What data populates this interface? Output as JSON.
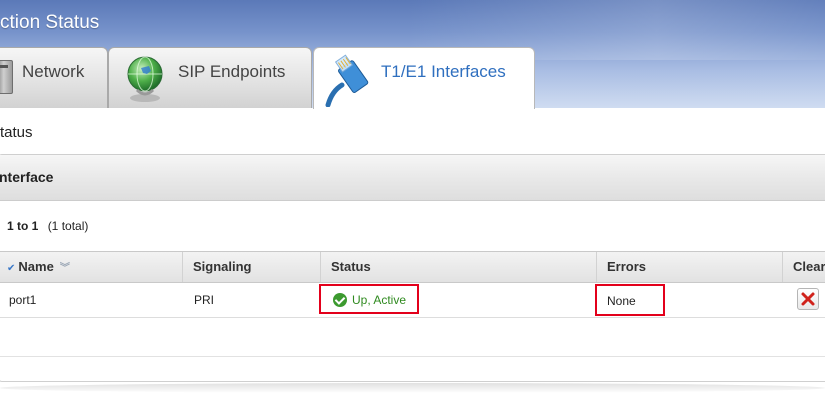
{
  "window": {
    "title": "ction Status"
  },
  "tabs": [
    {
      "label": "Network",
      "icon": "network-icon",
      "active": false
    },
    {
      "label": "SIP Endpoints",
      "icon": "globe-icon",
      "active": false
    },
    {
      "label": "T1/E1 Interfaces",
      "icon": "ethernet-cable-icon",
      "active": true
    }
  ],
  "section": {
    "title": "tatus"
  },
  "panel": {
    "title": "nterface",
    "pager": {
      "range": "1 to 1",
      "total": "(1 total)"
    }
  },
  "table": {
    "columns": [
      "Name",
      "Signaling",
      "Status",
      "Errors",
      "Clear"
    ],
    "rows": [
      {
        "name": "port1",
        "signaling": "PRI",
        "status": "Up, Active",
        "errors": "None"
      }
    ]
  },
  "colors": {
    "active_tab_text": "#2f6fbf",
    "status_ok": "#2f8a1f",
    "highlight_border": "#e3001b",
    "clear_icon": "#d0221b"
  }
}
